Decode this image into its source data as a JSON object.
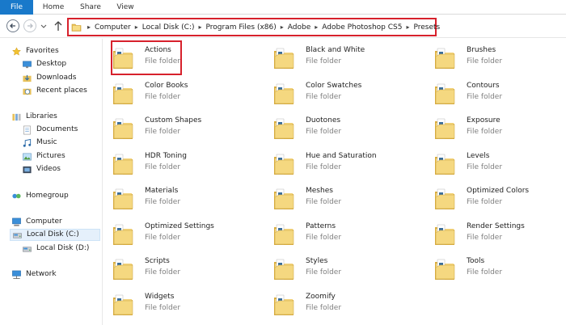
{
  "ribbon": {
    "tabs": [
      {
        "label": "File",
        "name": "tab-file"
      },
      {
        "label": "Home",
        "name": "tab-home"
      },
      {
        "label": "Share",
        "name": "tab-share"
      },
      {
        "label": "View",
        "name": "tab-view"
      }
    ],
    "file_color": "#1979ca"
  },
  "address": {
    "breadcrumbs": [
      "Computer",
      "Local Disk (C:)",
      "Program Files (x86)",
      "Adobe",
      "Adobe Photoshop CS5",
      "Presets"
    ],
    "highlight_color": "#d7212c"
  },
  "sidebar": {
    "items": [
      {
        "label": "Favorites",
        "icon": "star-icon"
      },
      {
        "label": "Desktop",
        "icon": "desktop-icon"
      },
      {
        "label": "Downloads",
        "icon": "downloads-icon"
      },
      {
        "label": "Recent places",
        "icon": "recent-places-icon"
      },
      {
        "label": "Libraries",
        "icon": "libraries-icon"
      },
      {
        "label": "Documents",
        "icon": "documents-icon"
      },
      {
        "label": "Music",
        "icon": "music-icon"
      },
      {
        "label": "Pictures",
        "icon": "pictures-icon"
      },
      {
        "label": "Videos",
        "icon": "videos-icon"
      },
      {
        "label": "Homegroup",
        "icon": "homegroup-icon"
      },
      {
        "label": "Computer",
        "icon": "computer-icon"
      },
      {
        "label": "Local Disk (C:)",
        "icon": "drive-icon",
        "selected": true
      },
      {
        "label": "Local Disk (D:)",
        "icon": "drive-icon"
      },
      {
        "label": "Network",
        "icon": "network-icon"
      }
    ]
  },
  "folders": [
    {
      "name": "Actions",
      "type": "File folder"
    },
    {
      "name": "Black and White",
      "type": "File folder"
    },
    {
      "name": "Brushes",
      "type": "File folder"
    },
    {
      "name": "Color Books",
      "type": "File folder"
    },
    {
      "name": "Color Swatches",
      "type": "File folder"
    },
    {
      "name": "Contours",
      "type": "File folder"
    },
    {
      "name": "Custom Shapes",
      "type": "File folder"
    },
    {
      "name": "Duotones",
      "type": "File folder"
    },
    {
      "name": "Exposure",
      "type": "File folder"
    },
    {
      "name": "HDR Toning",
      "type": "File folder"
    },
    {
      "name": "Hue and Saturation",
      "type": "File folder"
    },
    {
      "name": "Levels",
      "type": "File folder"
    },
    {
      "name": "Materials",
      "type": "File folder"
    },
    {
      "name": "Meshes",
      "type": "File folder"
    },
    {
      "name": "Optimized Colors",
      "type": "File folder"
    },
    {
      "name": "Optimized Settings",
      "type": "File folder"
    },
    {
      "name": "Patterns",
      "type": "File folder"
    },
    {
      "name": "Render Settings",
      "type": "File folder"
    },
    {
      "name": "Scripts",
      "type": "File folder"
    },
    {
      "name": "Styles",
      "type": "File folder"
    },
    {
      "name": "Tools",
      "type": "File folder"
    },
    {
      "name": "Widgets",
      "type": "File folder"
    },
    {
      "name": "Zoomify",
      "type": "File folder"
    }
  ]
}
